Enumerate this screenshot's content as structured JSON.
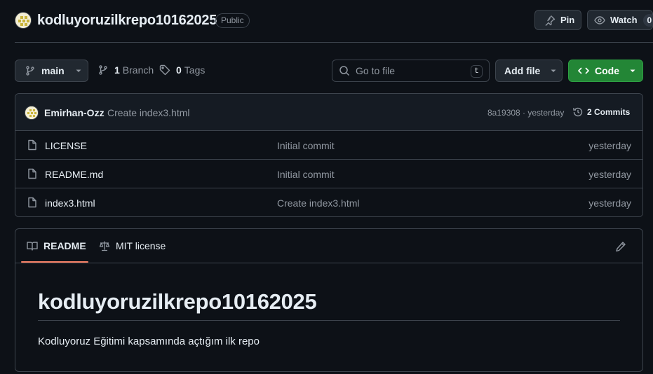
{
  "repo": {
    "name": "kodluyoruzilkrepo10162025",
    "visibility": "Public",
    "pin_label": "Pin",
    "watch_label": "Watch",
    "watch_count": "0"
  },
  "toolbar": {
    "branch": "main",
    "branch_count": "1",
    "branch_label": "Branch",
    "tag_count": "0",
    "tag_label": "Tags",
    "search_placeholder": "Go to file",
    "search_shortcut": "t",
    "add_file_label": "Add file",
    "code_label": "Code"
  },
  "latest_commit": {
    "author": "Emirhan-Ozz",
    "message": "Create index3.html",
    "sha_time": "8a19308 · yesterday",
    "commit_count": "2 Commits"
  },
  "files": [
    {
      "name": "LICENSE",
      "commit": "Initial commit",
      "date": "yesterday"
    },
    {
      "name": "README.md",
      "commit": "Initial commit",
      "date": "yesterday"
    },
    {
      "name": "index3.html",
      "commit": "Create index3.html",
      "date": "yesterday"
    }
  ],
  "readme": {
    "tab_readme": "README",
    "tab_license": "MIT license",
    "title": "kodluyoruzilkrepo10162025",
    "body": "Kodluyoruz Eğitimi kapsamında açtığım ilk repo"
  },
  "colors": {
    "background": "#0d1117",
    "border": "#3d444d",
    "code_button": "#238636",
    "tab_underline": "#f78166"
  },
  "icons": {
    "pin": "pin-icon",
    "watch": "eye-icon",
    "branch": "git-branch-icon",
    "tag": "tag-icon",
    "search": "search-icon",
    "code": "code-icon",
    "history": "history-icon",
    "file": "file-icon",
    "book": "book-icon",
    "law": "law-icon",
    "edit": "pencil-icon"
  }
}
